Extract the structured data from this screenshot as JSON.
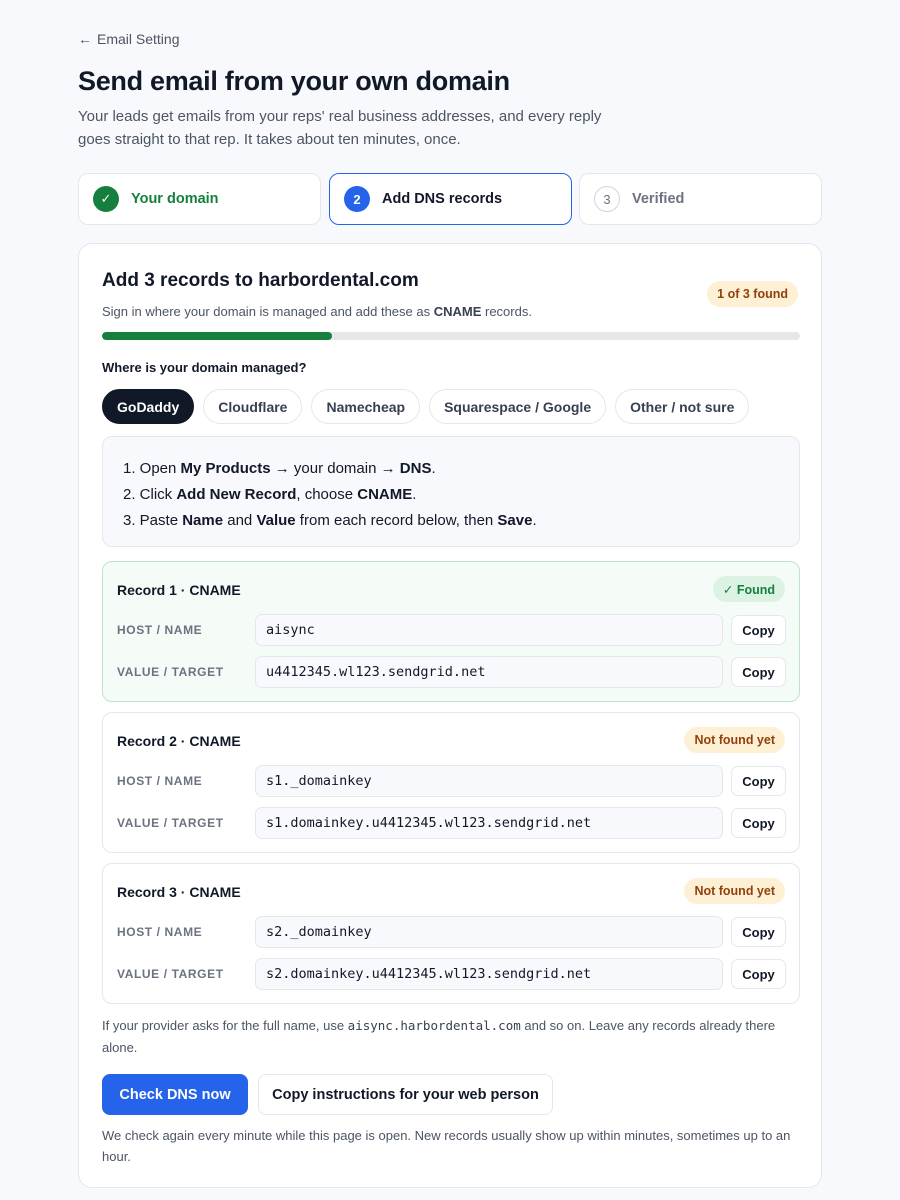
{
  "back_link": {
    "arrow": "←",
    "label": "Email Setting"
  },
  "page_title": "Send email from your own domain",
  "subtitle": "Your leads get emails from your reps' real business addresses, and every reply goes straight to that rep. It takes about ten minutes, once.",
  "steps": [
    {
      "badge": "✓",
      "label": "Your domain",
      "state": "done"
    },
    {
      "badge": "2",
      "label": "Add DNS records",
      "state": "current"
    },
    {
      "badge": "3",
      "label": "Verified",
      "state": "upcoming"
    }
  ],
  "card": {
    "title": "Add 3 records to harbordental.com",
    "subtitle_before": "Sign in where your domain is managed and add these as ",
    "subtitle_bold": "CNAME",
    "subtitle_after": " records.",
    "found_pill": "1 of 3 found",
    "progress_fraction": 0.33,
    "managed_label": "Where is your domain managed?",
    "providers": [
      "GoDaddy",
      "Cloudflare",
      "Namecheap",
      "Squarespace / Google",
      "Other / not sure"
    ],
    "selected_provider": "GoDaddy",
    "instructions": [
      [
        "1. Open ",
        "My Products",
        " → your domain → ",
        "DNS",
        "."
      ],
      [
        "2. Click ",
        "Add New Record",
        ", choose ",
        "CNAME",
        "."
      ],
      [
        "3. Paste ",
        "Name",
        " and ",
        "Value",
        " from each record below, then ",
        "Save",
        "."
      ]
    ],
    "field_labels": {
      "host": "HOST / NAME",
      "value": "VALUE / TARGET"
    },
    "copy_label": "Copy",
    "records": [
      {
        "title": "Record 1 · CNAME",
        "status": "✓ Found",
        "found": true,
        "host": "aisync",
        "value": "u4412345.wl123.sendgrid.net"
      },
      {
        "title": "Record 2 · CNAME",
        "status": "Not found yet",
        "found": false,
        "host": "s1._domainkey",
        "value": "s1.domainkey.u4412345.wl123.sendgrid.net"
      },
      {
        "title": "Record 3 · CNAME",
        "status": "Not found yet",
        "found": false,
        "host": "s2._domainkey",
        "value": "s2.domainkey.u4412345.wl123.sendgrid.net"
      }
    ],
    "note_before": "If your provider asks for the full name, use ",
    "note_code": "aisync.harbordental.com",
    "note_after": " and so on. Leave any records already there alone.",
    "primary_button": "Check DNS now",
    "secondary_button": "Copy instructions for your web person",
    "footnote": "We check again every minute while this page is open. New records usually show up within minutes, sometimes up to an hour."
  },
  "colors": {
    "accent": "#2563eb",
    "success": "#15803d",
    "warning_bg": "#fdf0d5",
    "warning_text": "#92400e",
    "dark": "#111827"
  }
}
